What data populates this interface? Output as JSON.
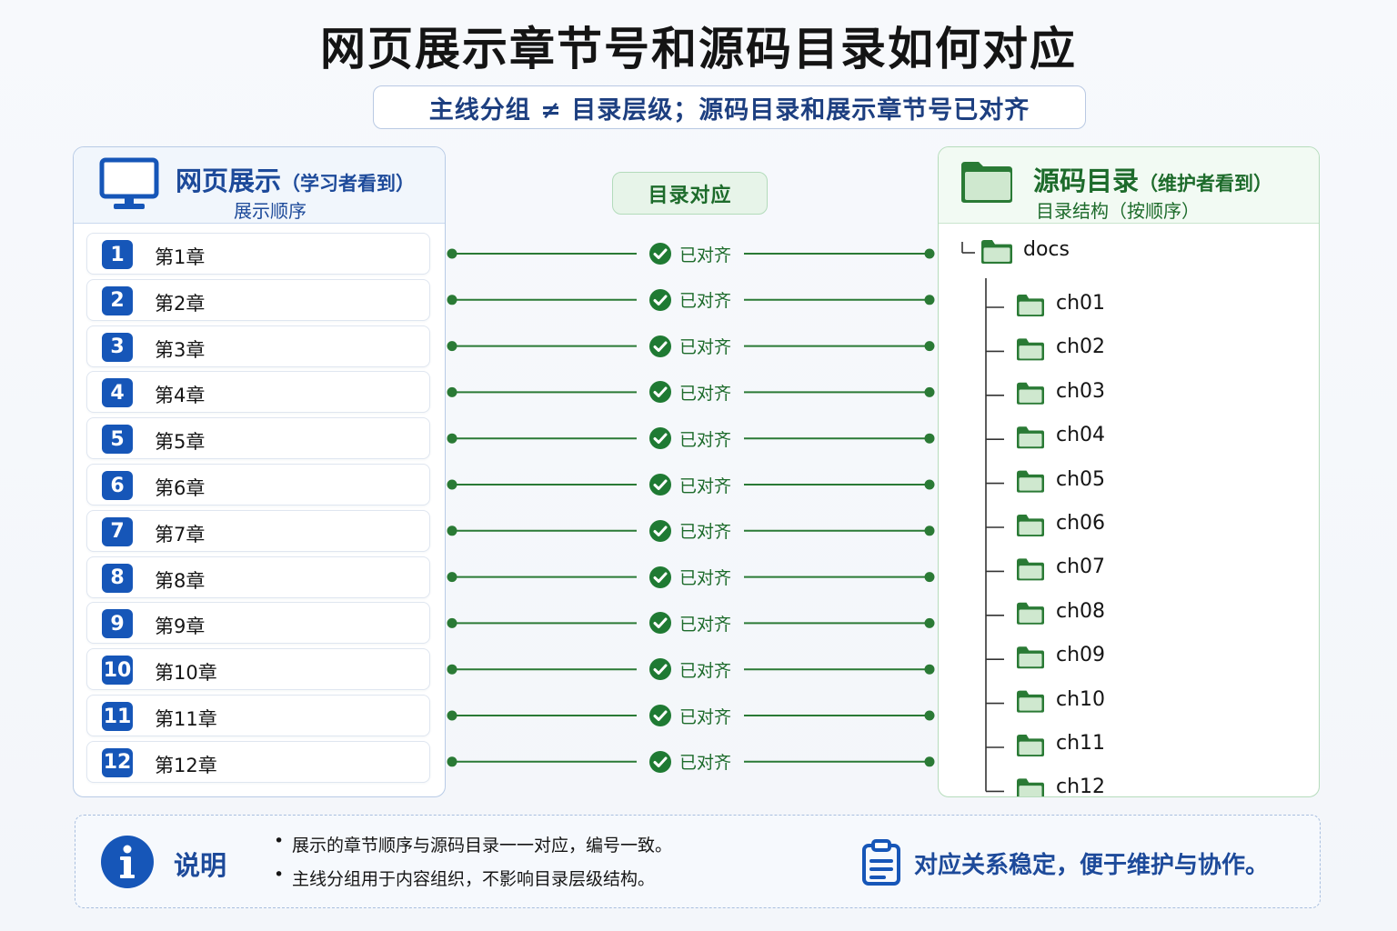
{
  "header": {
    "title": "网页展示章节号和源码目录如何对应",
    "subtitle": "主线分组 ≠ 目录层级；源码目录和展示章节号已对齐"
  },
  "left_panel": {
    "title": "网页展示",
    "title_note": "（学习者看到）",
    "subtitle": "展示顺序",
    "icon": "monitor-icon",
    "chapters": [
      {
        "num": "1",
        "label": "第1章"
      },
      {
        "num": "2",
        "label": "第2章"
      },
      {
        "num": "3",
        "label": "第3章"
      },
      {
        "num": "4",
        "label": "第4章"
      },
      {
        "num": "5",
        "label": "第5章"
      },
      {
        "num": "6",
        "label": "第6章"
      },
      {
        "num": "7",
        "label": "第7章"
      },
      {
        "num": "8",
        "label": "第8章"
      },
      {
        "num": "9",
        "label": "第9章"
      },
      {
        "num": "10",
        "label": "第10章"
      },
      {
        "num": "11",
        "label": "第11章"
      },
      {
        "num": "12",
        "label": "第12章"
      }
    ]
  },
  "middle": {
    "header": "目录对应",
    "status_label": "已对齐",
    "icon": "check-circle-icon"
  },
  "right_panel": {
    "title": "源码目录",
    "title_note": "（维护者看到）",
    "subtitle": "目录结构（按顺序）",
    "icon": "folder-icon",
    "root": "docs",
    "folders": [
      "ch01",
      "ch02",
      "ch03",
      "ch04",
      "ch05",
      "ch06",
      "ch07",
      "ch08",
      "ch09",
      "ch10",
      "ch11",
      "ch12"
    ]
  },
  "footer": {
    "heading": "说明",
    "bullets": [
      "展示的章节顺序与源码目录一一对应，编号一致。",
      "主线分组用于内容组织，不影响目录层级结构。"
    ],
    "note": "对应关系稳定，便于维护与协作。",
    "icons": [
      "info-icon",
      "clipboard-icon"
    ]
  },
  "colors": {
    "blue": "#1656b8",
    "green": "#1d6b2b",
    "folder_green": "#cfe8cf"
  }
}
